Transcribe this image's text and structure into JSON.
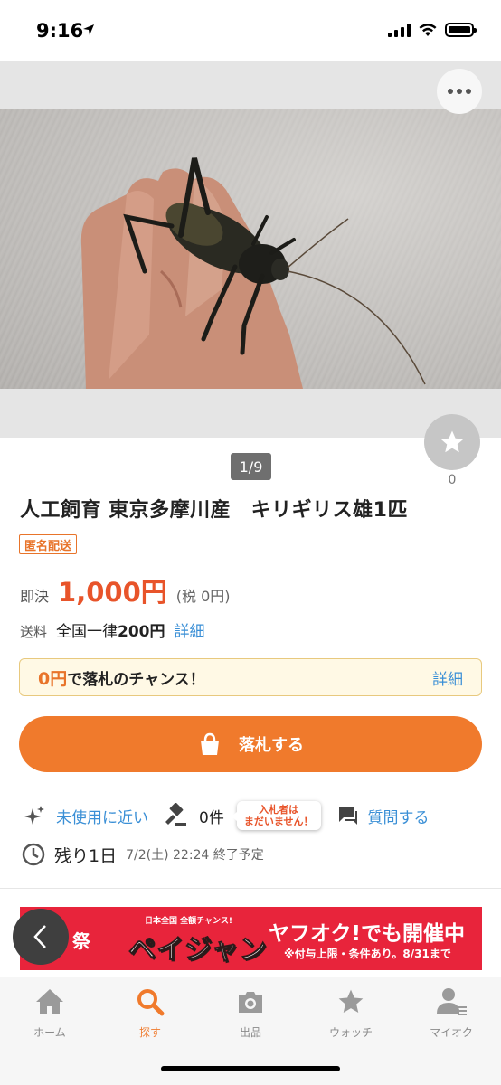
{
  "status_bar": {
    "time": "9:16"
  },
  "listing": {
    "photo_counter": "1/9",
    "watch_count": "0",
    "title": "人工飼育 東京多摩川産　キリギリス雄1匹",
    "anon_badge": "匿名配送",
    "price_label": "即決",
    "price": "1,000円",
    "tax": "(税 0円)",
    "shipping_label": "送料",
    "shipping_prefix": "全国一律",
    "shipping_amount": "200円",
    "shipping_detail": "詳細"
  },
  "chance": {
    "highlight": "0円",
    "text": "で落札のチャンス！",
    "detail": "詳細"
  },
  "bid_button": {
    "label": "落札する"
  },
  "info": {
    "condition": "未使用に近い",
    "bid_count": "0件",
    "bubble_line1": "入札者は",
    "bubble_line2": "まだいません！",
    "question": "質問する",
    "remaining": "残り1日",
    "end_time": "7/2(土) 22:24 終了予定"
  },
  "banner": {
    "left_text": "祭",
    "logo_small": "日本全国 全額チャンス!",
    "logo_main": "ペイジャンボ",
    "headline": "ヤフオク!でも開催中",
    "note": "※付与上限・条件あり。8/31まで"
  },
  "tabs": [
    {
      "label": "ホーム",
      "icon": "home-icon"
    },
    {
      "label": "探す",
      "icon": "search-icon"
    },
    {
      "label": "出品",
      "icon": "camera-icon"
    },
    {
      "label": "ウォッチ",
      "icon": "star-icon"
    },
    {
      "label": "マイオク",
      "icon": "user-icon"
    }
  ],
  "colors": {
    "accent": "#f07a2c",
    "price": "#e8542a",
    "link": "#3a8fd6",
    "banner": "#e8243b"
  }
}
